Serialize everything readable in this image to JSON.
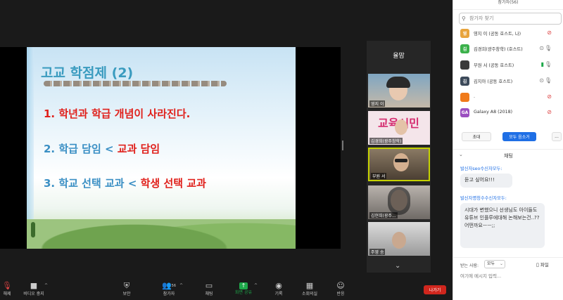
{
  "top_strip": {
    "left": "",
    "right": ""
  },
  "slide": {
    "title": "고교 학점제 (2)",
    "line1": "1. 학년과 학급 개념이 사라진다.",
    "line2_blue": "2. 학급 담임 < ",
    "line2_red": "교과 담임",
    "line3_blue": "3. 학교 선택 교과 < ",
    "line3_red": "학생 선택 교과"
  },
  "gallery": {
    "header": "율맘",
    "tiles": [
      {
        "name": "영지 이"
      },
      {
        "name": "김경희(광주창학)",
        "logo": "교육시민"
      },
      {
        "name": "부원 서"
      },
      {
        "name": "김현희(광주..."
      },
      {
        "name": "주영 송"
      }
    ]
  },
  "toolbar": {
    "audio": "해제",
    "video": "비디오 중지",
    "security": "보안",
    "participants": "참가자",
    "participants_count": "56",
    "chat": "채팅",
    "share": "화면 공유",
    "record": "기록",
    "rooms": "소회의실",
    "reactions": "반응",
    "leave": "나가기"
  },
  "panel": {
    "top_label": "참가자(56)",
    "search_placeholder": "참가자 찾기",
    "participants": [
      {
        "initial": "영",
        "name": "영지 이 (공동 호스트, 나)",
        "color": "#e8a43c"
      },
      {
        "initial": "김",
        "name": "김경희(광주창학) (호스트)",
        "color": "#3bb14b"
      },
      {
        "initial": "",
        "name": "부원 서 (공동 호스트)",
        "color": "#3a3a3a"
      },
      {
        "initial": "김",
        "name": "김지아 (공동 호스트)",
        "color": "#3c4a5a"
      },
      {
        "initial": "",
        "name": ".",
        "color": "#f07a1a"
      },
      {
        "initial": "GA",
        "name": "Galaxy A8 (2018)",
        "color": "#9b4fc0"
      }
    ],
    "invite": "초대",
    "mute_all": "모두 음소거",
    "more": "..."
  },
  "chat": {
    "title": "채팅",
    "messages": [
      {
        "from": "발신자seo수신자모두:",
        "text": "듣고 싶어요!!!"
      },
      {
        "from": "발신자명청수수신자모두:",
        "text": "시대가 변했으니 선생님도 아이들도 유튜브 인플루에대해 논해보는건..??어떤까요ㅡㅡ;;"
      }
    ],
    "to_label": "받는 사람:",
    "to_value": "모두",
    "file": "파일",
    "input_placeholder": "여기에 메시지 입력..."
  }
}
